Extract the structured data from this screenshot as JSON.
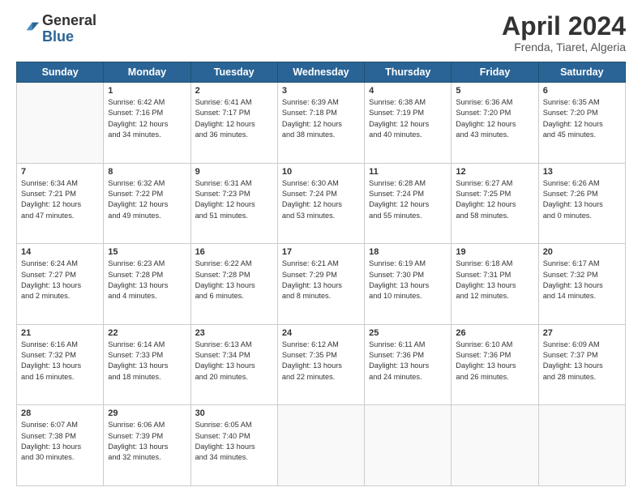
{
  "header": {
    "logo_general": "General",
    "logo_blue": "Blue",
    "month_title": "April 2024",
    "location": "Frenda, Tiaret, Algeria"
  },
  "days_of_week": [
    "Sunday",
    "Monday",
    "Tuesday",
    "Wednesday",
    "Thursday",
    "Friday",
    "Saturday"
  ],
  "weeks": [
    [
      {
        "day": "",
        "detail": ""
      },
      {
        "day": "1",
        "detail": "Sunrise: 6:42 AM\nSunset: 7:16 PM\nDaylight: 12 hours\nand 34 minutes."
      },
      {
        "day": "2",
        "detail": "Sunrise: 6:41 AM\nSunset: 7:17 PM\nDaylight: 12 hours\nand 36 minutes."
      },
      {
        "day": "3",
        "detail": "Sunrise: 6:39 AM\nSunset: 7:18 PM\nDaylight: 12 hours\nand 38 minutes."
      },
      {
        "day": "4",
        "detail": "Sunrise: 6:38 AM\nSunset: 7:19 PM\nDaylight: 12 hours\nand 40 minutes."
      },
      {
        "day": "5",
        "detail": "Sunrise: 6:36 AM\nSunset: 7:20 PM\nDaylight: 12 hours\nand 43 minutes."
      },
      {
        "day": "6",
        "detail": "Sunrise: 6:35 AM\nSunset: 7:20 PM\nDaylight: 12 hours\nand 45 minutes."
      }
    ],
    [
      {
        "day": "7",
        "detail": "Sunrise: 6:34 AM\nSunset: 7:21 PM\nDaylight: 12 hours\nand 47 minutes."
      },
      {
        "day": "8",
        "detail": "Sunrise: 6:32 AM\nSunset: 7:22 PM\nDaylight: 12 hours\nand 49 minutes."
      },
      {
        "day": "9",
        "detail": "Sunrise: 6:31 AM\nSunset: 7:23 PM\nDaylight: 12 hours\nand 51 minutes."
      },
      {
        "day": "10",
        "detail": "Sunrise: 6:30 AM\nSunset: 7:24 PM\nDaylight: 12 hours\nand 53 minutes."
      },
      {
        "day": "11",
        "detail": "Sunrise: 6:28 AM\nSunset: 7:24 PM\nDaylight: 12 hours\nand 55 minutes."
      },
      {
        "day": "12",
        "detail": "Sunrise: 6:27 AM\nSunset: 7:25 PM\nDaylight: 12 hours\nand 58 minutes."
      },
      {
        "day": "13",
        "detail": "Sunrise: 6:26 AM\nSunset: 7:26 PM\nDaylight: 13 hours\nand 0 minutes."
      }
    ],
    [
      {
        "day": "14",
        "detail": "Sunrise: 6:24 AM\nSunset: 7:27 PM\nDaylight: 13 hours\nand 2 minutes."
      },
      {
        "day": "15",
        "detail": "Sunrise: 6:23 AM\nSunset: 7:28 PM\nDaylight: 13 hours\nand 4 minutes."
      },
      {
        "day": "16",
        "detail": "Sunrise: 6:22 AM\nSunset: 7:28 PM\nDaylight: 13 hours\nand 6 minutes."
      },
      {
        "day": "17",
        "detail": "Sunrise: 6:21 AM\nSunset: 7:29 PM\nDaylight: 13 hours\nand 8 minutes."
      },
      {
        "day": "18",
        "detail": "Sunrise: 6:19 AM\nSunset: 7:30 PM\nDaylight: 13 hours\nand 10 minutes."
      },
      {
        "day": "19",
        "detail": "Sunrise: 6:18 AM\nSunset: 7:31 PM\nDaylight: 13 hours\nand 12 minutes."
      },
      {
        "day": "20",
        "detail": "Sunrise: 6:17 AM\nSunset: 7:32 PM\nDaylight: 13 hours\nand 14 minutes."
      }
    ],
    [
      {
        "day": "21",
        "detail": "Sunrise: 6:16 AM\nSunset: 7:32 PM\nDaylight: 13 hours\nand 16 minutes."
      },
      {
        "day": "22",
        "detail": "Sunrise: 6:14 AM\nSunset: 7:33 PM\nDaylight: 13 hours\nand 18 minutes."
      },
      {
        "day": "23",
        "detail": "Sunrise: 6:13 AM\nSunset: 7:34 PM\nDaylight: 13 hours\nand 20 minutes."
      },
      {
        "day": "24",
        "detail": "Sunrise: 6:12 AM\nSunset: 7:35 PM\nDaylight: 13 hours\nand 22 minutes."
      },
      {
        "day": "25",
        "detail": "Sunrise: 6:11 AM\nSunset: 7:36 PM\nDaylight: 13 hours\nand 24 minutes."
      },
      {
        "day": "26",
        "detail": "Sunrise: 6:10 AM\nSunset: 7:36 PM\nDaylight: 13 hours\nand 26 minutes."
      },
      {
        "day": "27",
        "detail": "Sunrise: 6:09 AM\nSunset: 7:37 PM\nDaylight: 13 hours\nand 28 minutes."
      }
    ],
    [
      {
        "day": "28",
        "detail": "Sunrise: 6:07 AM\nSunset: 7:38 PM\nDaylight: 13 hours\nand 30 minutes."
      },
      {
        "day": "29",
        "detail": "Sunrise: 6:06 AM\nSunset: 7:39 PM\nDaylight: 13 hours\nand 32 minutes."
      },
      {
        "day": "30",
        "detail": "Sunrise: 6:05 AM\nSunset: 7:40 PM\nDaylight: 13 hours\nand 34 minutes."
      },
      {
        "day": "",
        "detail": ""
      },
      {
        "day": "",
        "detail": ""
      },
      {
        "day": "",
        "detail": ""
      },
      {
        "day": "",
        "detail": ""
      }
    ]
  ]
}
